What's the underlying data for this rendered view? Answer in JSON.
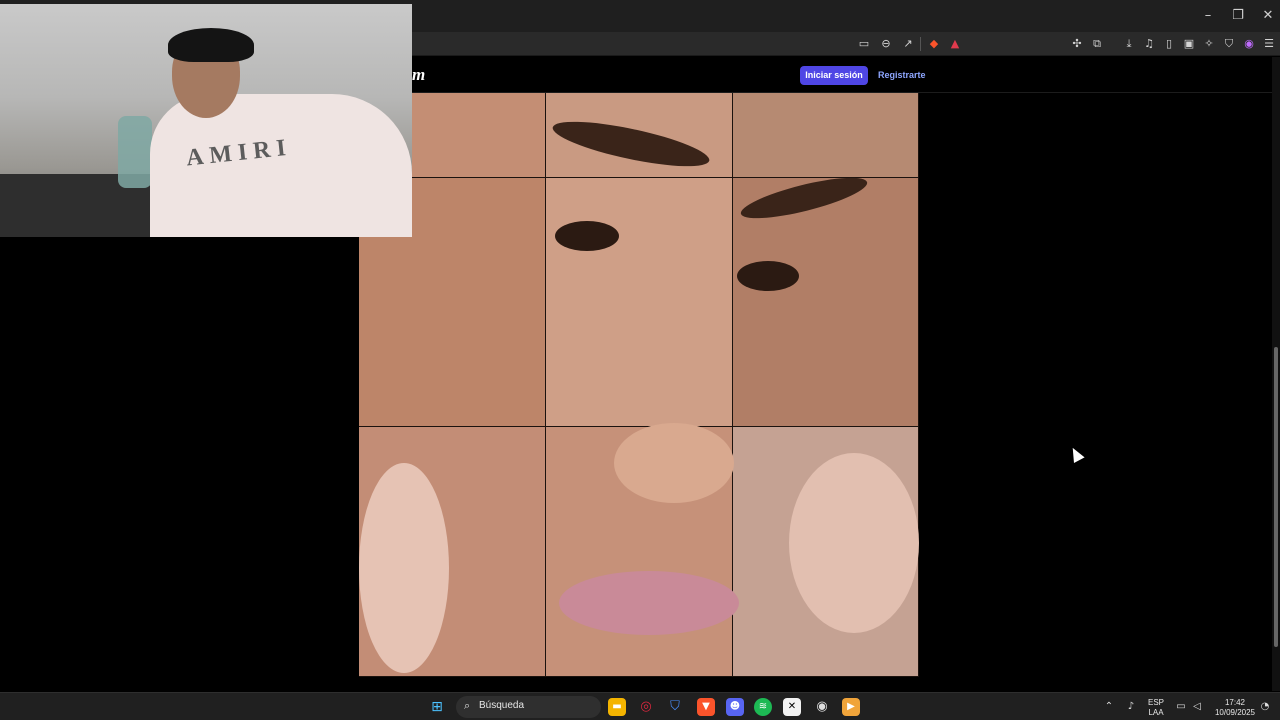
{
  "browser": {
    "window_controls": {
      "minimize": "–",
      "restore": "❐",
      "close": "✕"
    },
    "toolbar_icons": [
      "cast-icon",
      "zoom-out-icon",
      "share-icon",
      "brave-shields-icon",
      "brave-rewards-icon",
      "extensions-icon",
      "screenshot-icon",
      "download-icon",
      "media-icon",
      "sidebar-icon",
      "wallet-icon",
      "leo-ai-icon",
      "vpn-icon",
      "profile-icon",
      "menu-icon"
    ]
  },
  "site": {
    "logo_fragment": "m",
    "login_label": "Iniciar sesión",
    "register_label": "Registrarte",
    "accent": "#4f46e5"
  },
  "puzzle": {
    "grid": "3x3 sliding image puzzle"
  },
  "webcam": {
    "hoodie_text": "AMIRI"
  },
  "taskbar": {
    "search_placeholder": "Búsqueda",
    "apps": [
      "windows-start-icon",
      "file-explorer-icon",
      "opera-gx-icon",
      "security-icon",
      "brave-icon",
      "discord-icon",
      "spotify-icon",
      "capcut-icon",
      "steam-icon",
      "media-player-icon"
    ],
    "tray": {
      "language_top": "ESP",
      "language_bottom": "LAA",
      "time": "17:42",
      "date": "10/09/2025"
    }
  }
}
